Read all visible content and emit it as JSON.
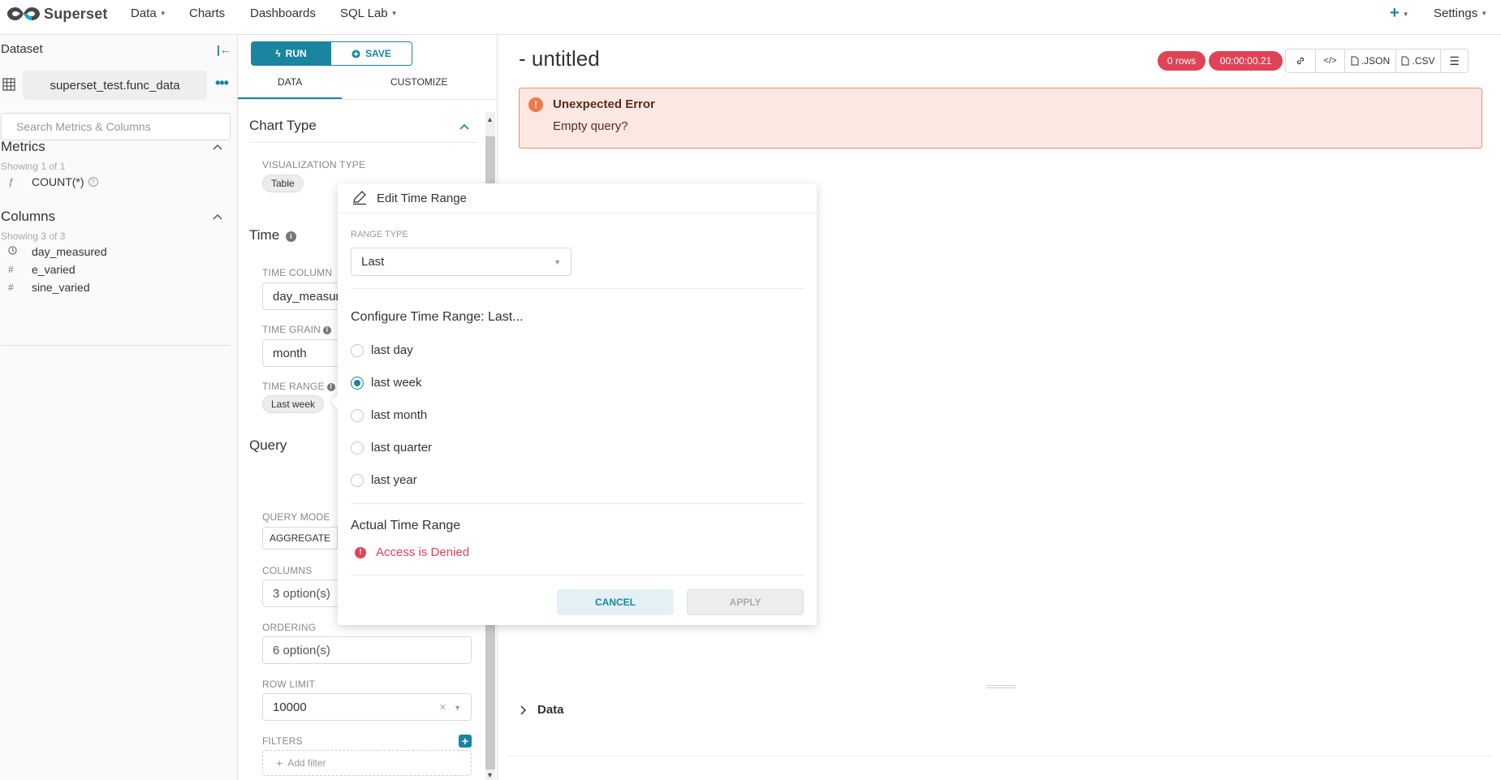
{
  "navbar": {
    "brand": "Superset",
    "items": [
      {
        "label": "Data",
        "dropdown": true
      },
      {
        "label": "Charts",
        "dropdown": false
      },
      {
        "label": "Dashboards",
        "dropdown": false
      },
      {
        "label": "SQL Lab",
        "dropdown": true
      }
    ],
    "plus_icon": "plus-icon",
    "settings_label": "Settings"
  },
  "dataset_panel": {
    "title": "Dataset",
    "dataset_name": "superset_test.func_data",
    "search_placeholder": "Search Metrics & Columns",
    "metrics": {
      "title": "Metrics",
      "showing": "Showing 1 of 1",
      "items": [
        {
          "icon": "ƒ",
          "label": "COUNT(*)"
        }
      ]
    },
    "columns": {
      "title": "Columns",
      "showing": "Showing 3 of 3",
      "items": [
        {
          "icon": "clock-icon",
          "label": "day_measured"
        },
        {
          "icon": "#",
          "label": "e_varied"
        },
        {
          "icon": "#",
          "label": "sine_varied"
        }
      ]
    }
  },
  "control_panel": {
    "run_label": "RUN",
    "save_label": "SAVE",
    "tabs": [
      "DATA",
      "CUSTOMIZE"
    ],
    "active_tab": "DATA",
    "chart_type": {
      "title": "Chart Type",
      "viz_label": "VISUALIZATION TYPE",
      "viz_value": "Table"
    },
    "time": {
      "title": "Time",
      "column_label": "TIME COLUMN",
      "column_value": "day_measured",
      "grain_label": "TIME GRAIN",
      "grain_value": "month",
      "range_label": "TIME RANGE",
      "range_value": "Last week"
    },
    "query": {
      "title": "Query",
      "mode_label": "QUERY MODE",
      "mode_value": "AGGREGATE",
      "columns_label": "COLUMNS",
      "columns_value": "3 option(s)",
      "ordering_label": "ORDERING",
      "ordering_value": "6 option(s)",
      "row_limit_label": "ROW LIMIT",
      "row_limit_value": "10000",
      "filters_label": "FILTERS",
      "add_filter_label": "Add filter"
    }
  },
  "chart_area": {
    "title": "- untitled",
    "rows_badge": "0 rows",
    "time_badge": "00:00:00.21",
    "json_label": ".JSON",
    "csv_label": ".CSV",
    "error_title": "Unexpected Error",
    "error_message": "Empty query?",
    "data_section_label": "Data"
  },
  "time_range_popover": {
    "title": "Edit Time Range",
    "range_type_label": "RANGE TYPE",
    "range_type_value": "Last",
    "configure_heading": "Configure Time Range: Last...",
    "options": [
      "last day",
      "last week",
      "last month",
      "last quarter",
      "last year"
    ],
    "selected_option": "last week",
    "actual_heading": "Actual Time Range",
    "actual_value": "Access is Denied",
    "cancel_label": "CANCEL",
    "apply_label": "APPLY"
  },
  "colors": {
    "primary": "#1a85a0",
    "danger": "#e04355",
    "error_bg": "#fce8e2",
    "error_border": "#f28c6e"
  }
}
